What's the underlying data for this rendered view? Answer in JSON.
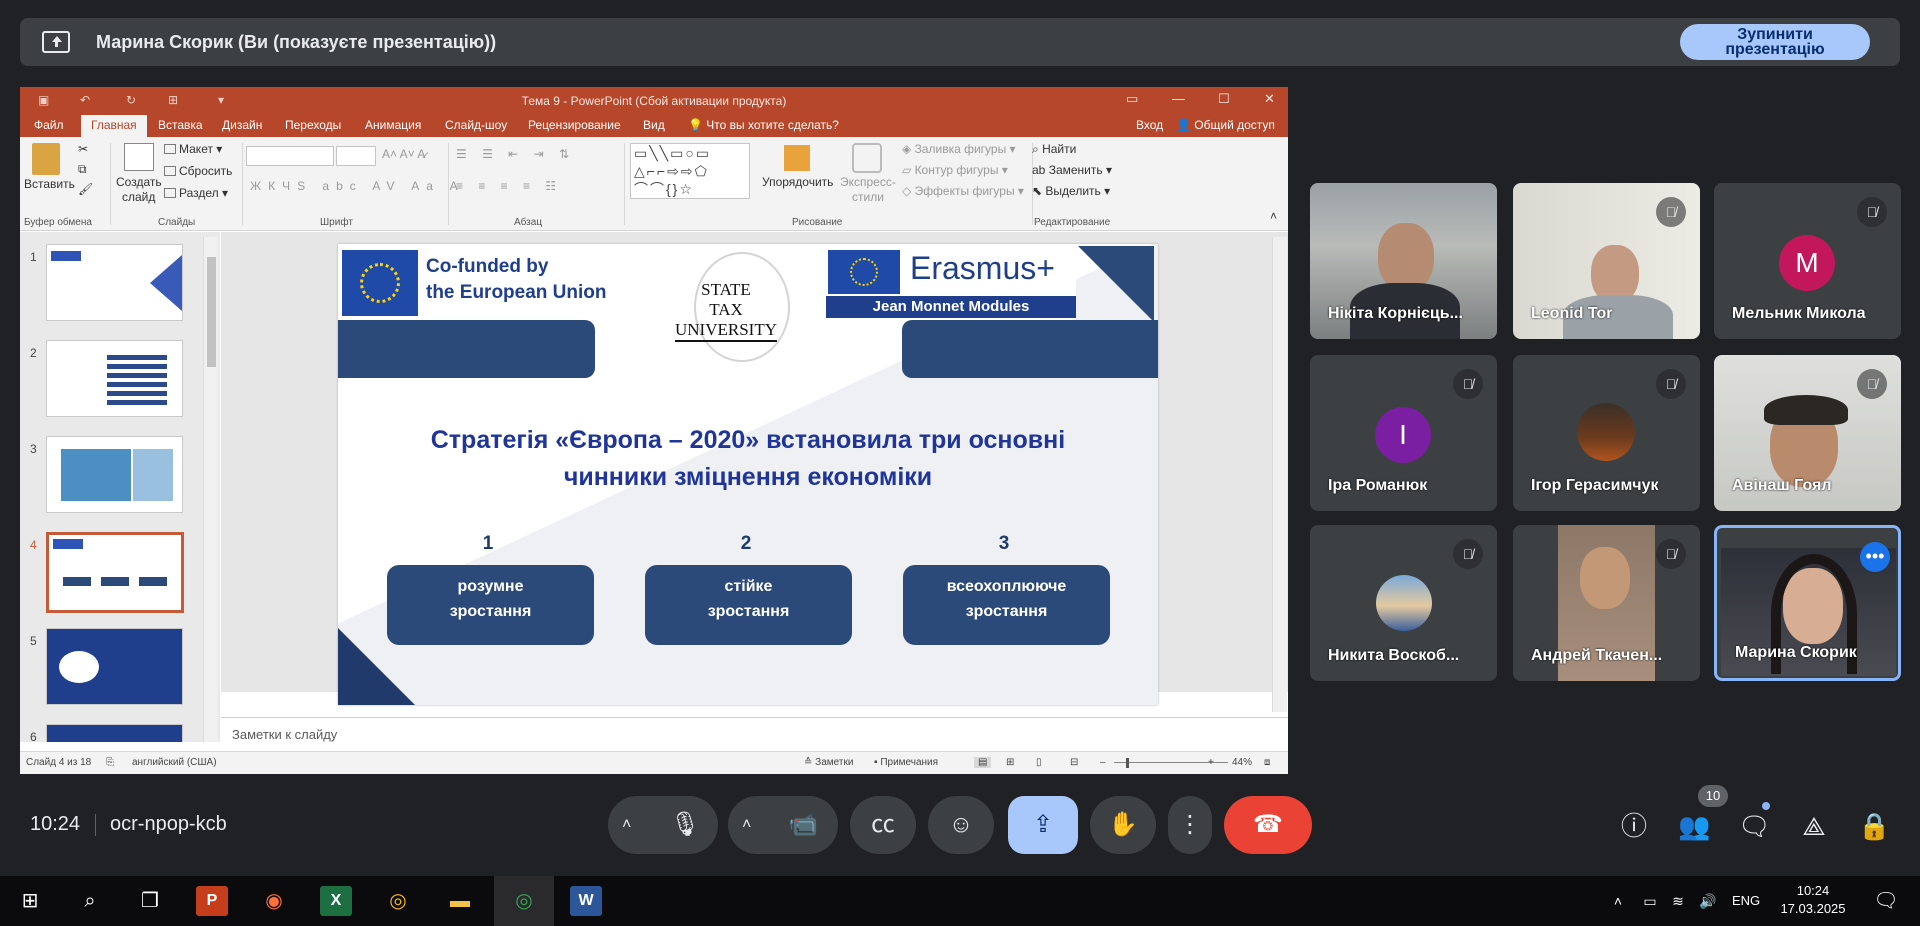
{
  "banner": {
    "title": "Марина Скорик (Ви (показуєте презентацію))",
    "stop_label_1": "Зупинити",
    "stop_label_2": "презентацію"
  },
  "ppt": {
    "window_title": "Тема 9 - PowerPoint (Сбой активации продукта)",
    "tabs": [
      "Файл",
      "Главная",
      "Вставка",
      "Дизайн",
      "Переходы",
      "Анимация",
      "Слайд-шоу",
      "Рецензирование",
      "Вид"
    ],
    "tell_me": "Что вы хотите сделать?",
    "signin": "Вход",
    "share": "Общий доступ",
    "ribbon": {
      "paste": "Вставить",
      "new_slide_1": "Создать",
      "new_slide_2": "слайд",
      "layout": "Макет",
      "reset": "Сбросить",
      "section": "Раздел",
      "arrange": "Упорядочить",
      "quick_styles_1": "Экспресс-",
      "quick_styles_2": "стили",
      "shape_fill": "Заливка фигуры",
      "shape_outline": "Контур фигуры",
      "shape_effects": "Эффекты фигуры",
      "find": "Найти",
      "replace": "Заменить",
      "select": "Выделить",
      "groups": {
        "clipboard": "Буфер обмена",
        "slides": "Слайды",
        "font": "Шрифт",
        "paragraph": "Абзац",
        "drawing": "Рисование",
        "editing": "Редактирование"
      }
    },
    "thumb_numbers": [
      "1",
      "2",
      "3",
      "4",
      "5",
      "6"
    ],
    "notes_placeholder": "Заметки к слайду",
    "status": {
      "slide": "Слайд 4 из 18",
      "lang": "английский (США)",
      "notes": "Заметки",
      "comments": "Примечания",
      "zoom": "44%"
    }
  },
  "slide": {
    "eu_line1": "Co-funded by",
    "eu_line2": "the European Union",
    "stu_line1": "STATE",
    "stu_line2": "TAX",
    "stu_line3": "UNIVERSITY",
    "erasmus": "Erasmus+",
    "jean_monnet": "Jean Monnet Modules",
    "heading_1": "Стратегія «Європа – 2020» встановила три основні",
    "heading_2": "чинники зміцнення економіки",
    "items": [
      {
        "num": "1",
        "line1": "розумне",
        "line2": "зростання"
      },
      {
        "num": "2",
        "line1": "стійке",
        "line2": "зростання"
      },
      {
        "num": "3",
        "line1": "всеохоплююче",
        "line2": "зростання"
      }
    ]
  },
  "participants": [
    {
      "name": "Нікіта Корнієць...",
      "kind": "video",
      "muted": false
    },
    {
      "name": "Leonid Tor",
      "kind": "video",
      "muted": true
    },
    {
      "name": "Мельник Микола",
      "kind": "avatar",
      "initial": "M",
      "color": "#c2185b",
      "muted": true
    },
    {
      "name": "Іра Романюк",
      "kind": "avatar",
      "initial": "I",
      "color": "#7b1fa2",
      "muted": true
    },
    {
      "name": "Ігор Герасимчук",
      "kind": "photo",
      "muted": true
    },
    {
      "name": "Авінаш Гоял",
      "kind": "video",
      "muted": true
    },
    {
      "name": "Никита Воскоб...",
      "kind": "photo",
      "muted": true
    },
    {
      "name": "Андрей Ткачен...",
      "kind": "video",
      "muted": true
    },
    {
      "name": "Марина Скорик",
      "kind": "video",
      "muted": false
    }
  ],
  "meeting": {
    "time": "10:24",
    "code": "ocr-npop-kcb",
    "people_count": "10"
  },
  "taskbar": {
    "time": "10:24",
    "date": "17.03.2025",
    "lang": "ENG"
  }
}
